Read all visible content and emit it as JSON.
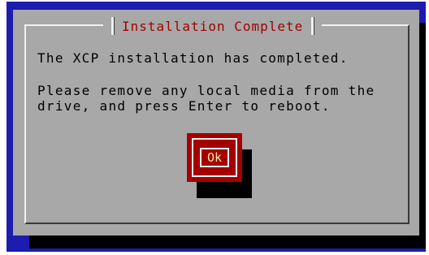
{
  "dialog": {
    "title": "Installation Complete",
    "message_line1": "The XCP installation has completed.",
    "message_line2": "Please remove any local media from the",
    "message_line3": "drive, and press Enter to reboot.",
    "ok_label": "Ok"
  },
  "colors": {
    "background": "#1c1cae",
    "dialog": "#a8a8a8",
    "title_text": "#a40000",
    "button": "#a40000",
    "shadow": "#000000"
  }
}
